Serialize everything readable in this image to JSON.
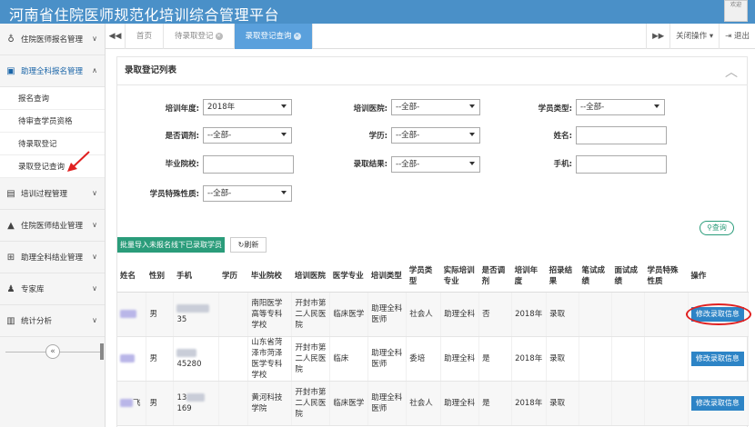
{
  "header": {
    "title": "河南省住院医师规范化培训综合管理平台",
    "avatar_text": "欢迎"
  },
  "sidebar": {
    "items": [
      {
        "label": "住院医师报名管理",
        "icon": "stethoscope-icon"
      },
      {
        "label": "助理全科报名管理",
        "icon": "medkit-icon"
      },
      {
        "label": "培训过程管理",
        "icon": "document-icon"
      },
      {
        "label": "住院医师结业管理",
        "icon": "graduation-cap-icon"
      },
      {
        "label": "助理全科结业管理",
        "icon": "plus-square-icon"
      },
      {
        "label": "专家库",
        "icon": "user-icon"
      },
      {
        "label": "统计分析",
        "icon": "bar-chart-icon"
      }
    ],
    "sub_items": [
      "报名查询",
      "待审查学员资格",
      "待录取登记",
      "录取登记查询"
    ]
  },
  "tabs": {
    "items": [
      "首页",
      "待录取登记",
      "录取登记查询"
    ],
    "close_ops": "关闭操作",
    "logout": "退出"
  },
  "panel": {
    "title": "录取登记列表"
  },
  "form": {
    "year_label": "培训年度:",
    "year_value": "2018年",
    "hospital_label": "培训医院:",
    "hospital_value": "--全部-",
    "student_type_label": "学员类型:",
    "student_type_value": "--全部-",
    "adjust_label": "是否调剂:",
    "adjust_value": "--全部-",
    "edu_label": "学历:",
    "edu_value": "--全部-",
    "name_label": "姓名:",
    "school_label": "毕业院校:",
    "result_label": "录取结果:",
    "result_value": "--全部-",
    "phone_label": "手机:",
    "special_label": "学员特殊性质:",
    "special_value": "--全部-"
  },
  "buttons": {
    "query": "查询",
    "import": "批量导入未报名线下已录取学员",
    "refresh": "刷新"
  },
  "table": {
    "headers": [
      "姓名",
      "性别",
      "手机",
      "学历",
      "毕业院校",
      "培训医院",
      "医学专业",
      "培训类型",
      "学员类型",
      "实际培训专业",
      "是否调剂",
      "培训年度",
      "招录结果",
      "笔试成绩",
      "面试成绩",
      "学员特殊性质",
      "操作"
    ],
    "rows": [
      {
        "gender": "男",
        "phone_tail": "35",
        "school": "南阳医学高等专科学校",
        "hospital": "开封市第二人民医院",
        "major": "临床医学",
        "train_type": "助理全科医师",
        "student_type": "社会人",
        "actual_major": "助理全科",
        "adjust": "否",
        "year": "2018年",
        "result": "录取"
      },
      {
        "gender": "男",
        "phone_tail": "45280",
        "school": "山东省菏泽市菏泽医学专科学校",
        "hospital": "开封市第二人民医院",
        "major": "临床",
        "train_type": "助理全科医师",
        "student_type": "委培",
        "actual_major": "助理全科",
        "adjust": "是",
        "year": "2018年",
        "result": "录取"
      },
      {
        "name_tail": "飞",
        "gender": "男",
        "phone_head": "13",
        "phone_tail": "169",
        "school": "黄河科技学院",
        "hospital": "开封市第二人民医院",
        "major": "临床医学",
        "train_type": "助理全科医师",
        "student_type": "社会人",
        "actual_major": "助理全科",
        "adjust": "是",
        "year": "2018年",
        "result": "录取"
      }
    ],
    "edit_label": "修改录取信息"
  }
}
